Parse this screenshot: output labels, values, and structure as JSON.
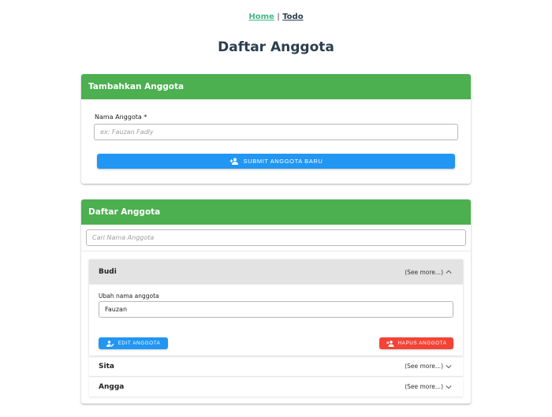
{
  "nav": {
    "home": "Home",
    "separator": "|",
    "todo": "Todo"
  },
  "page_title": "Daftar Anggota",
  "add_card": {
    "header": "Tambahkan Anggota",
    "field_label": "Nama Anggota *",
    "placeholder": "ex: Fauzan Fadly",
    "value": "",
    "submit_label": "SUBMIT ANGGOTA BARU",
    "submit_icon": "person-add-icon"
  },
  "list_card": {
    "header": "Daftar Anggota",
    "search_placeholder": "Cari Nama Anggota",
    "search_value": "",
    "members": [
      {
        "name": "Budi",
        "expanded": true,
        "more_label": "(See more...)",
        "edit_label": "Ubah nama anggota",
        "edit_value": "Fauzan",
        "edit_button": "EDIT ANGGOTA",
        "delete_button": "HAPUS ANGGOTA"
      },
      {
        "name": "Sita",
        "expanded": false,
        "more_label": "(See more...)"
      },
      {
        "name": "Angga",
        "expanded": false,
        "more_label": "(See more...)"
      }
    ]
  },
  "colors": {
    "header_green": "#4caf50",
    "primary_blue": "#2196f3",
    "danger_red": "#f44336",
    "nav_active": "#42b983",
    "text_dark": "#2c3e50"
  }
}
